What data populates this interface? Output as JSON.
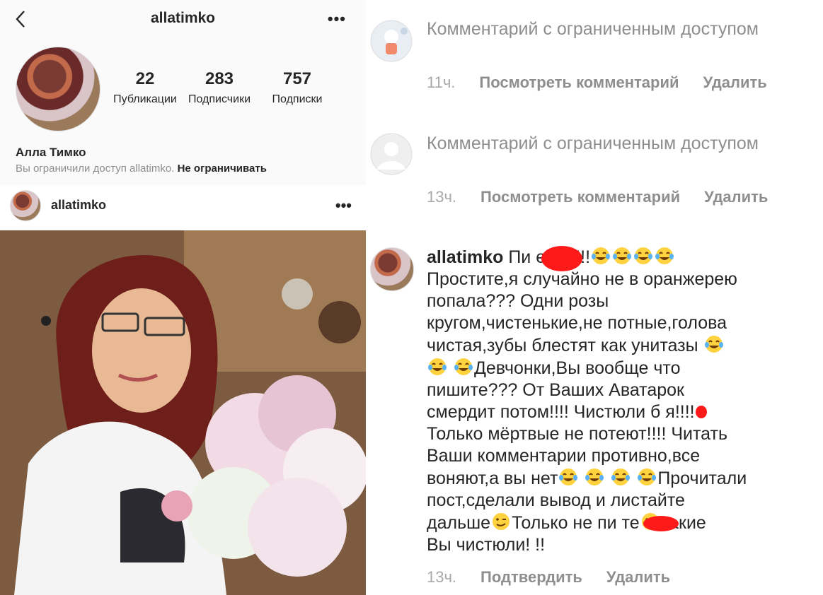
{
  "profile": {
    "username": "allatimko",
    "full_name": "Алла Тимко",
    "stats": [
      {
        "value": "22",
        "label": "Публикации"
      },
      {
        "value": "283",
        "label": "Подписчики"
      },
      {
        "value": "757",
        "label": "Подписки"
      }
    ],
    "restrict_note": "Вы ограничили доступ allatimko.",
    "unrestrict_label": "Не ограничивать"
  },
  "post": {
    "username": "allatimko"
  },
  "comments": [
    {
      "text": "Комментарий с ограниченным доступом",
      "time": "11ч.",
      "view_label": "Посмотреть комментарий",
      "delete_label": "Удалить"
    },
    {
      "text": "Комментарий с ограниченным доступом",
      "time": "13ч.",
      "view_label": "Посмотреть комментарий",
      "delete_label": "Удалить"
    },
    {
      "username": "allatimko",
      "text_lines": [
        "Пи      еец!!!!!",
        "Простите,я случайно не в оранжерею",
        "попала??? Одни розы",
        "кругом,чистенькие,не потные,голова",
        "чистая,зубы блестят как унитазы",
        "Девчонки,Вы вообще что",
        "пишите??? От Ваших Аватарок",
        "смердит потом!!!! Чистюли б  я!!!!",
        "Только мёртвые не потеют!!!! Читать",
        "Ваши комментарии противно,все",
        "воняют,а вы нет",
        "Прочитали",
        "пост,сделали вывод и листайте",
        "дальше",
        "Только не пи     те",
        "какие",
        "Вы чистюли! !!"
      ],
      "time": "13ч.",
      "confirm_label": "Подтвердить",
      "delete_label": "Удалить"
    }
  ],
  "icons": {
    "back": "chevron-left-icon",
    "more": "more-horizontal-icon",
    "emoji_laugh": "tears-of-joy-emoji",
    "emoji_wink": "wink-emoji",
    "emoji_sad": "confused-emoji"
  },
  "colors": {
    "redaction": "#ff1a1a",
    "muted_text": "#8e8e8e"
  }
}
